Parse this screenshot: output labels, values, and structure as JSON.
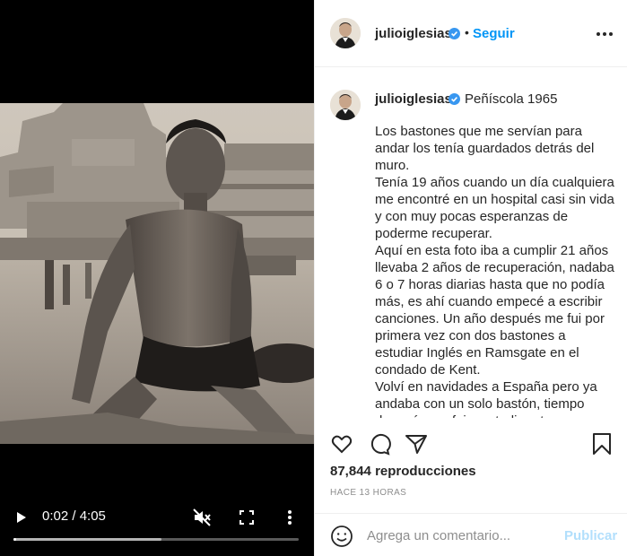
{
  "post": {
    "username": "julioiglesias",
    "follow_label": "Seguir",
    "separator": "•",
    "location": "Peñíscola 1965",
    "caption": "Los bastones que me servían para andar los tenía guardados detrás del muro.\nTenía 19 años cuando un día cualquiera me encontré en un hospital casi sin vida y con muy pocas esperanzas de poderme recuperar.\nAquí en esta foto iba a cumplir 21 años llevaba 2 años de recuperación, nadaba 6 o 7 horas diarias hasta que no podía más, es ahí cuando empecé a escribir canciones. Un año después me fui por primera vez con dos bastones a estudiar Inglés en Ramsgate en el condado de Kent.\nVolví en navidades a España pero ya andaba con un solo bastón, tiempo después me fui a estudiar otra vez a",
    "views_count": "87,844",
    "views_label": "reproducciones",
    "timestamp": "Hace 13 horas"
  },
  "video": {
    "time_display": "0:02 / 4:05",
    "progress_fraction": 0.008,
    "buffered_fraction": 0.52,
    "icons": {
      "play": "play-icon",
      "mute": "muted-speaker-icon",
      "fullscreen": "fullscreen-icon",
      "more": "more-vertical-icon"
    }
  },
  "actions": {
    "icons": [
      "heart-icon",
      "comment-icon",
      "share-icon",
      "bookmark-icon"
    ]
  },
  "comment_box": {
    "placeholder": "Agrega un comentario...",
    "publish_label": "Publicar"
  },
  "colors": {
    "accent": "#0095f6",
    "publish_disabled": "#b2dffc",
    "verified": "#3897f0",
    "text": "#262626",
    "muted": "#8e8e8e",
    "media_background": "#000000"
  }
}
